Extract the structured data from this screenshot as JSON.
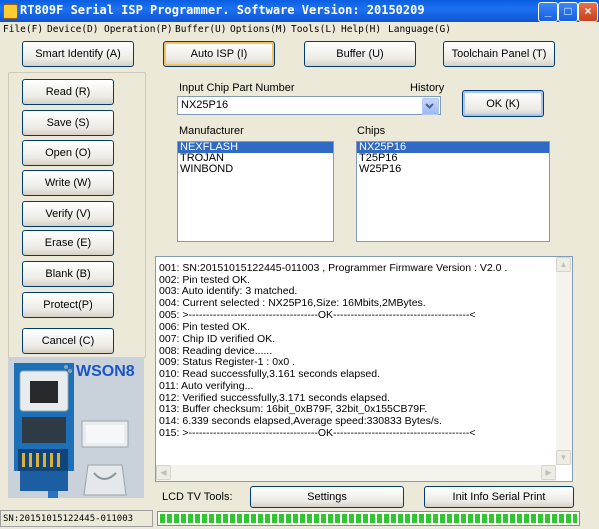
{
  "window": {
    "title": "RT809F Serial ISP Programmer. Software Version: 20150209"
  },
  "menu": [
    "File(F)",
    "Device(D)",
    "Operation(P)",
    "Buffer(U)",
    "Options(M)",
    "Tools(L)",
    "Help(H)",
    "Language(G)"
  ],
  "top_buttons": {
    "smart_identify": "Smart Identify (A)",
    "auto_isp": "Auto ISP (I)",
    "buffer": "Buffer (U)",
    "toolchain": "Toolchain Panel (T)"
  },
  "side_buttons": {
    "read": "Read (R)",
    "save": "Save (S)",
    "open": "Open (O)",
    "write": "Write (W)",
    "verify": "Verify (V)",
    "erase": "Erase (E)",
    "blank": "Blank (B)",
    "protect": "Protect(P)",
    "cancel": "Cancel (C)"
  },
  "chip_select": {
    "input_label": "Input Chip Part Number",
    "history_label": "History",
    "value": "NX25P16",
    "ok_label": "OK (K)",
    "manufacturer_label": "Manufacturer",
    "chips_label": "Chips",
    "manufacturers": [
      "NEXFLASH",
      "TROJAN",
      "WINBOND"
    ],
    "chips": [
      "NX25P16",
      "T25P16",
      "W25P16"
    ]
  },
  "chip_image": {
    "package": "WSON8"
  },
  "log": [
    "001: SN:20151015122445-011003 , Programmer Firmware Version : V2.0 .",
    "002: Pin tested OK.",
    "003: Auto identify: 3 matched.",
    "004: Current selected : NX25P16,Size: 16Mbits,2MBytes.",
    "005: >-------------------------------------OK---------------------------------------<",
    "006: Pin tested OK.",
    "007: Chip ID verified OK.",
    "008: Reading device......",
    "009: Status Register-1 : 0x0 .",
    "010: Read successfully,3.161 seconds elapsed.",
    "011: Auto verifying...",
    "012: Verified successfully,3.171 seconds elapsed.",
    "013: Buffer checksum: 16bit_0xB79F, 32bit_0x155CB79F.",
    "014: 6.339 seconds elapsed,Average speed:330833 Bytes/s.",
    "015: >-------------------------------------OK---------------------------------------<"
  ],
  "lcd": {
    "label": "LCD TV Tools:",
    "settings": "Settings",
    "init_print": "Init Info Serial Print"
  },
  "status": {
    "sn": "SN:20151015122445-011003",
    "progress": 1.0
  },
  "icons": {
    "minimize": "minimize-icon",
    "maximize": "maximize-icon",
    "close": "close-icon"
  }
}
